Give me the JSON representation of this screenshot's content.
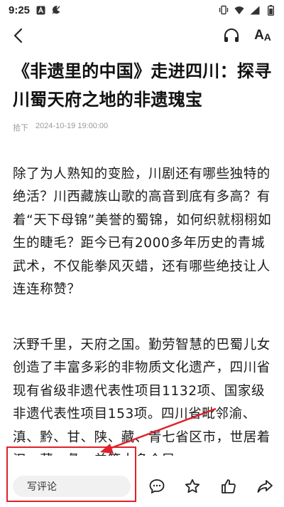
{
  "status_bar": {
    "time": "9:25",
    "icons": [
      "notification-a-icon",
      "do-not-disturb-icon",
      "vibrate-icon",
      "wifi-icon",
      "signal-icon",
      "battery-icon"
    ]
  },
  "nav": {
    "back_icon": "chevron-left-icon",
    "listen_icon": "headphone-icon",
    "font_size_label_big": "A",
    "font_size_label_small": "A"
  },
  "article": {
    "title": "《非遗里的中国》走进四川：探寻川蜀天府之地的非遗瑰宝",
    "source": "拾下",
    "datetime": "2024-10-19 19:00:00",
    "paragraphs": [
      "除了为人熟知的变脸，川剧还有哪些独特的绝活？川西藏族山歌的高音到底有多高？有着“天下母锦”美誉的蜀锦，如何织就栩栩如生的睫毛？距今已有2000多年历史的青城武术，不仅能拳风灭蜡，还有哪些绝技让人连连称赞？",
      "沃野千里，天府之国。勤劳智慧的巴蜀儿女创造了丰富多彩的非物质文化遗产，四川省现有省级非遗代表性项目1132项、国家级非遗代表性项目153项。四川省毗邻渝、滇、黔、甘、陕、藏、青七省区市，世居着汉、藏、彝、羌等十多个民"
    ]
  },
  "toolbar": {
    "comment_placeholder": "写评论",
    "icons": [
      "comment-icon",
      "star-icon",
      "thumbs-up-icon",
      "share-icon"
    ]
  },
  "colors": {
    "annotation": "#e0212b",
    "input_bg": "#f1f1f1",
    "meta_text": "#999999"
  }
}
